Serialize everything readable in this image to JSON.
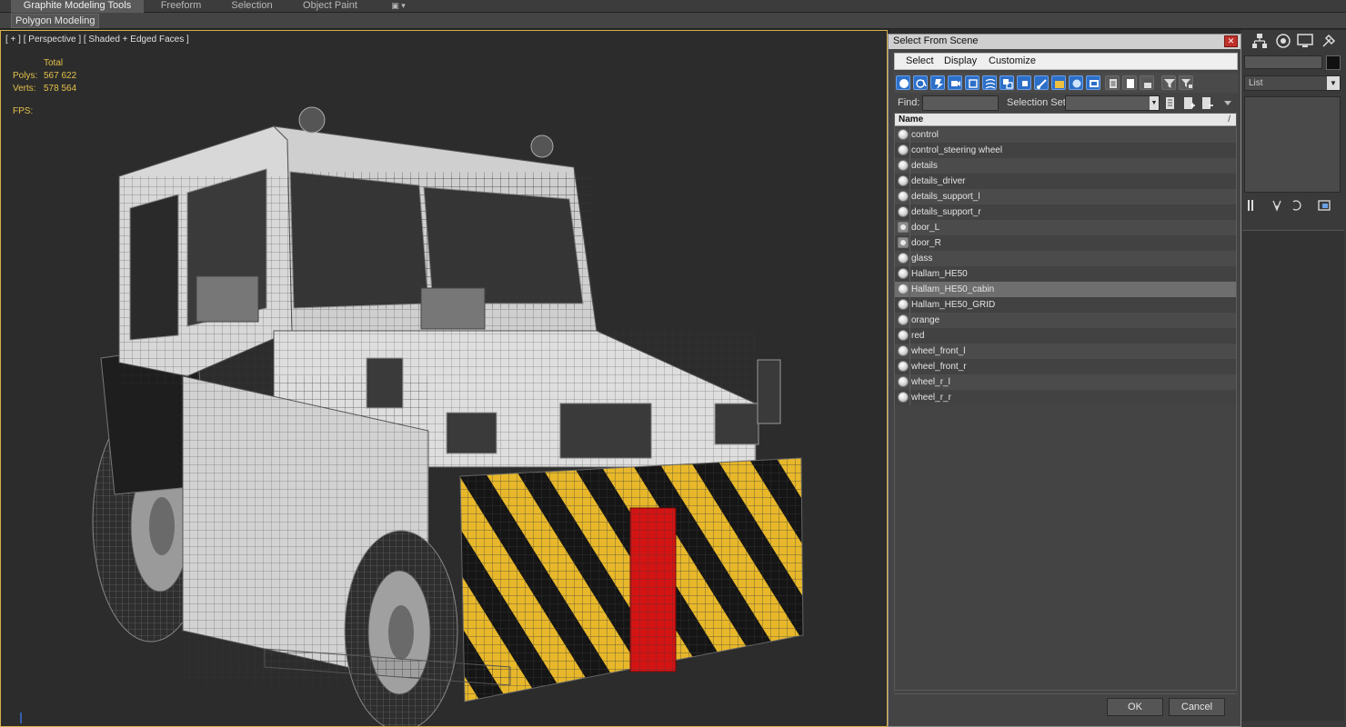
{
  "ribbon": {
    "tabs": [
      {
        "label": "Graphite Modeling Tools",
        "active": true
      },
      {
        "label": "Freeform"
      },
      {
        "label": "Selection"
      },
      {
        "label": "Object Paint"
      },
      {
        "label": "▣ ▾"
      }
    ],
    "sub_button": "Polygon Modeling"
  },
  "viewport": {
    "label": "[ + ] [ Perspective ] [ Shaded + Edged Faces ]",
    "stats": {
      "total_label": "Total",
      "polys_label": "Polys:",
      "polys_value": "567 622",
      "verts_label": "Verts:",
      "verts_value": "578 564",
      "fps_label": "FPS:"
    },
    "colors": {
      "border": "#d6b24a",
      "stats": "#e2c04a",
      "stripe_yellow": "#e8b82a",
      "hook_red": "#d41414"
    }
  },
  "command_panel": {
    "dropdown_text": "List"
  },
  "dialog": {
    "title": "Select From Scene",
    "close_glyph": "✕",
    "menu": [
      "Select",
      "Display",
      "Customize"
    ],
    "find_label": "Find:",
    "find_value": "",
    "selection_set_label": "Selection Set:",
    "list_header": "Name",
    "sort_glyph": "/",
    "items": [
      {
        "name": "control",
        "icon": "sphere"
      },
      {
        "name": "control_steering wheel",
        "icon": "sphere"
      },
      {
        "name": "details",
        "icon": "sphere"
      },
      {
        "name": "details_driver",
        "icon": "sphere"
      },
      {
        "name": "details_support_l",
        "icon": "sphere"
      },
      {
        "name": "details_support_r",
        "icon": "sphere"
      },
      {
        "name": "door_L",
        "icon": "group"
      },
      {
        "name": "door_R",
        "icon": "group"
      },
      {
        "name": "glass",
        "icon": "sphere"
      },
      {
        "name": "Hallam_HE50",
        "icon": "sphere"
      },
      {
        "name": "Hallam_HE50_cabin",
        "icon": "sphere",
        "selected": true
      },
      {
        "name": "Hallam_HE50_GRID",
        "icon": "sphere"
      },
      {
        "name": "orange",
        "icon": "sphere"
      },
      {
        "name": "red",
        "icon": "sphere"
      },
      {
        "name": "wheel_front_l",
        "icon": "sphere"
      },
      {
        "name": "wheel_front_r",
        "icon": "sphere"
      },
      {
        "name": "wheel_r_l",
        "icon": "sphere"
      },
      {
        "name": "wheel_r_r",
        "icon": "sphere"
      }
    ],
    "ok_label": "OK",
    "cancel_label": "Cancel"
  }
}
